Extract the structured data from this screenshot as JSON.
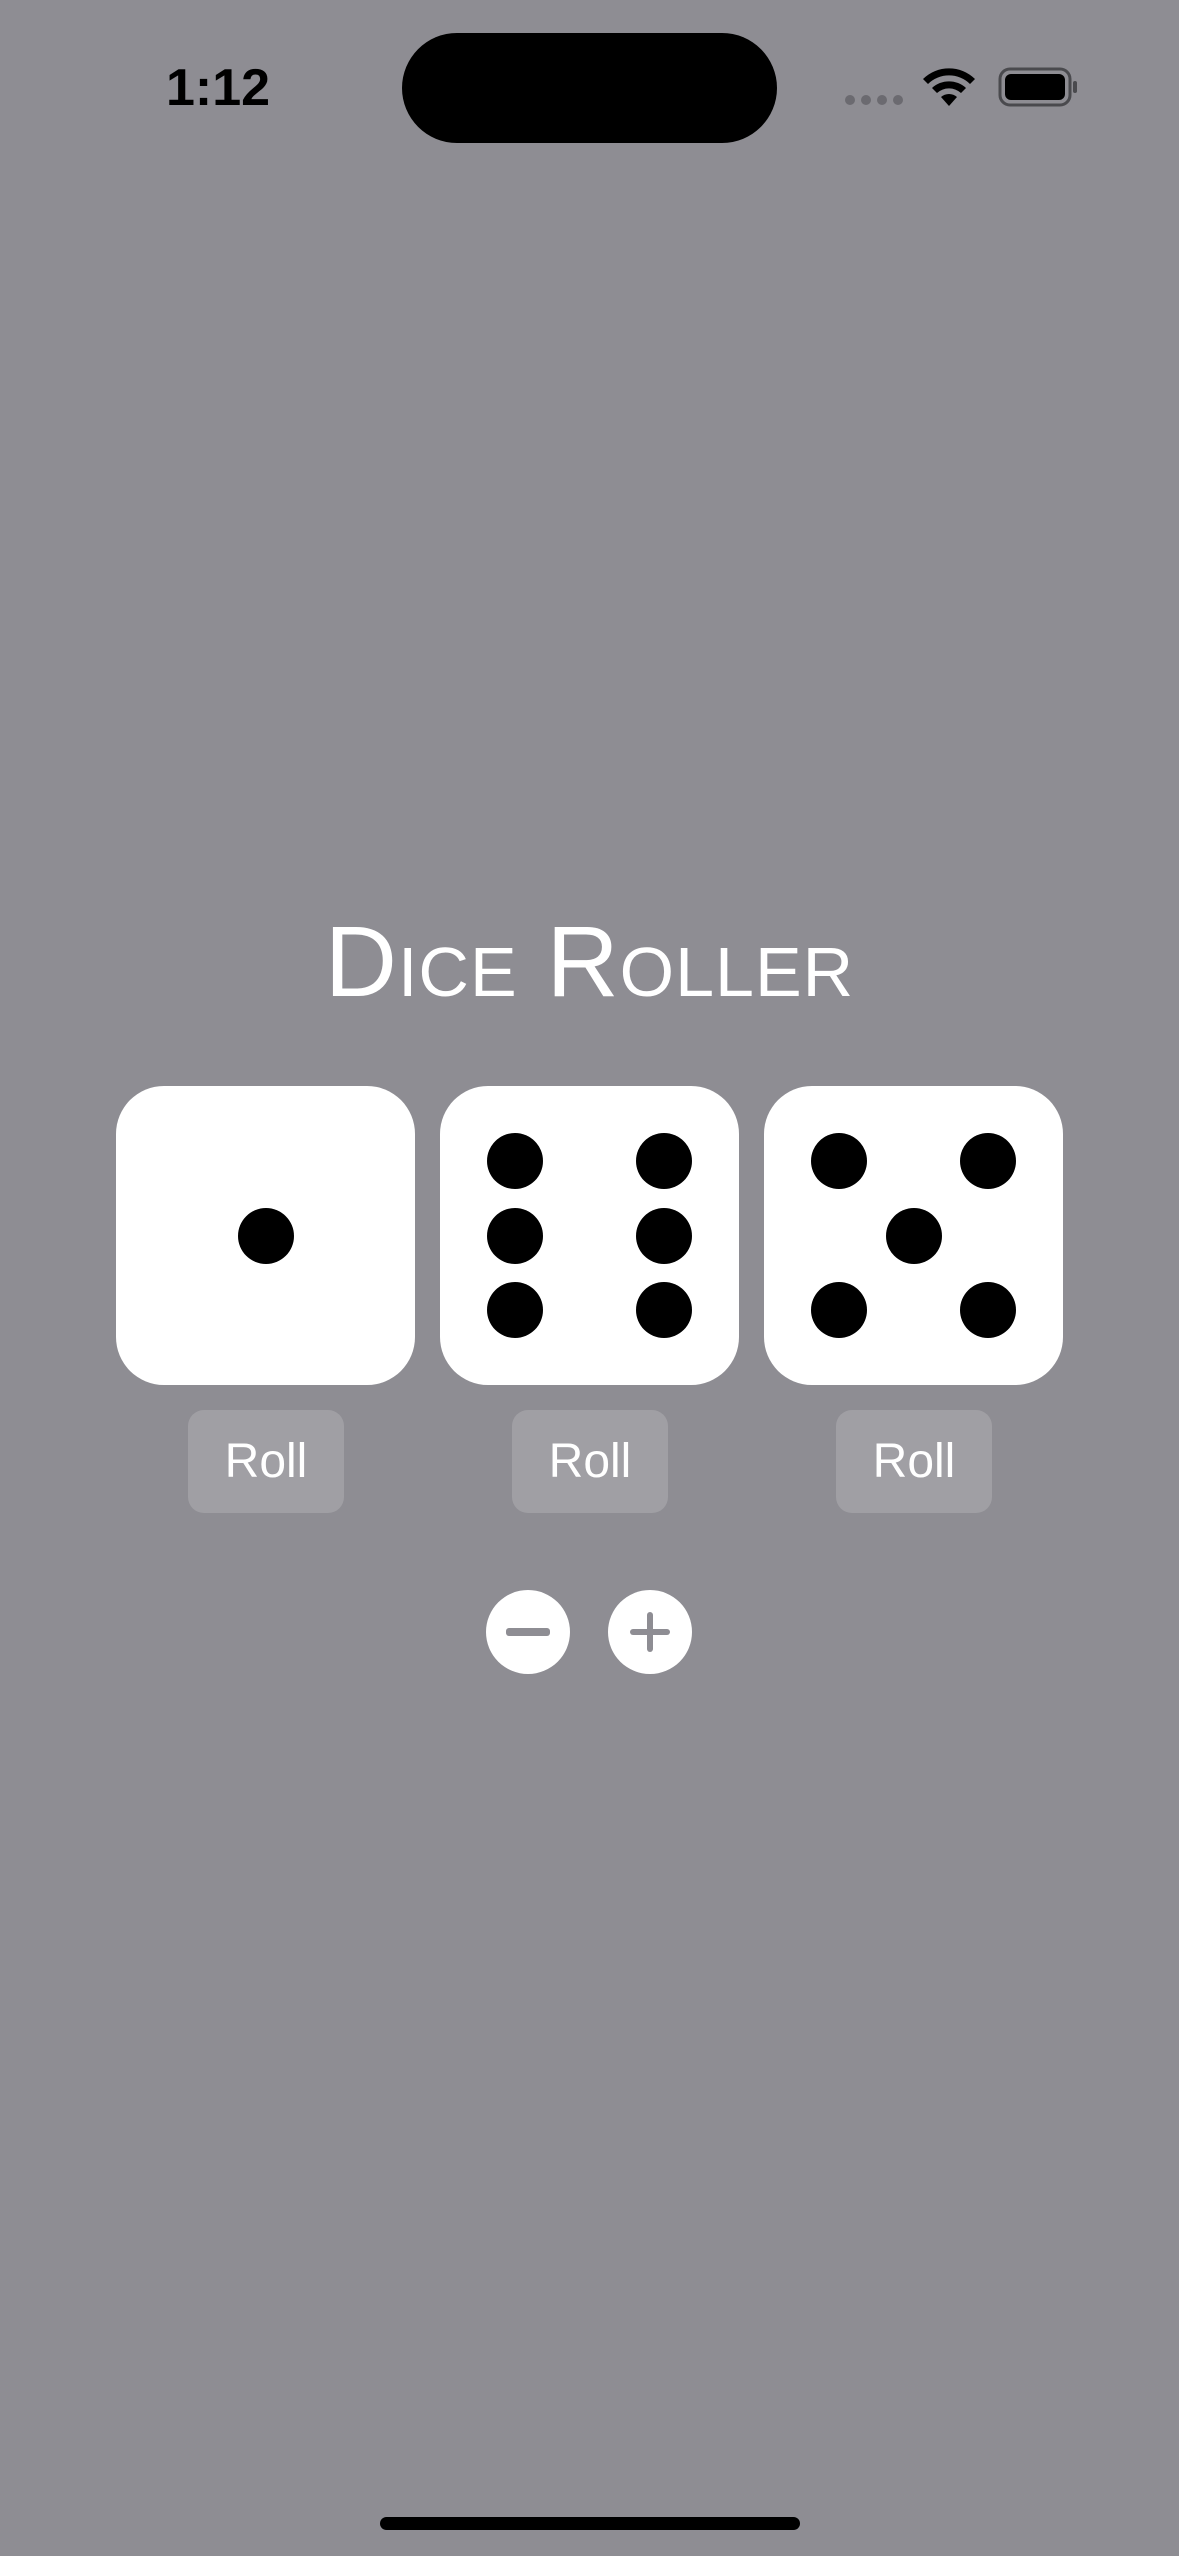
{
  "status_bar": {
    "time": "1:12"
  },
  "app": {
    "title": "Dice Roller"
  },
  "dice": [
    {
      "value": 1,
      "roll_label": "Roll"
    },
    {
      "value": 6,
      "roll_label": "Roll"
    },
    {
      "value": 5,
      "roll_label": "Roll"
    }
  ],
  "controls": {
    "decrease_icon": "minus-icon",
    "increase_icon": "plus-icon"
  },
  "colors": {
    "background": "#8e8d93",
    "die_face": "#ffffff",
    "pip": "#000000"
  }
}
